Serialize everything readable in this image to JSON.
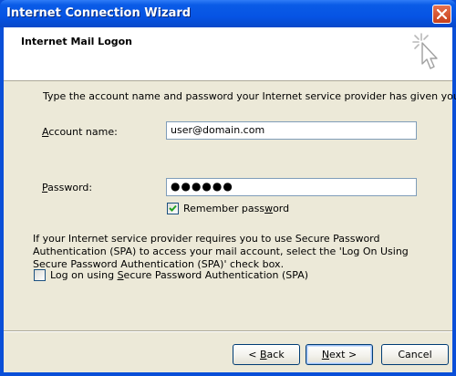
{
  "window": {
    "title": "Internet Connection Wizard"
  },
  "header": {
    "title": "Internet Mail Logon",
    "icon": "wizard-sparkle-cursor-icon"
  },
  "intro_text": "Type the account name and password your Internet service provider has given you.",
  "account": {
    "label_mnemonic": "A",
    "label_rest": "ccount name:",
    "value": "user@domain.com"
  },
  "password": {
    "label_mnemonic": "P",
    "label_rest": "assword:",
    "value": "●●●●●●"
  },
  "remember": {
    "label_pre": "Remember pass",
    "label_mnemonic": "w",
    "label_post": "ord",
    "checked": true
  },
  "spa_info": "If your Internet service provider requires you to use Secure Password Authentication (SPA) to access your mail account, select the 'Log On Using Secure Password Authentication (SPA)' check box.",
  "spa_checkbox": {
    "label_pre": "Log on using ",
    "label_mnemonic": "S",
    "label_post": "ecure Password Authentication (SPA)",
    "checked": false
  },
  "buttons": {
    "back_pre": "< ",
    "back_mnemonic": "B",
    "back_post": "ack",
    "next_mnemonic": "N",
    "next_post": "ext >",
    "cancel": "Cancel"
  }
}
